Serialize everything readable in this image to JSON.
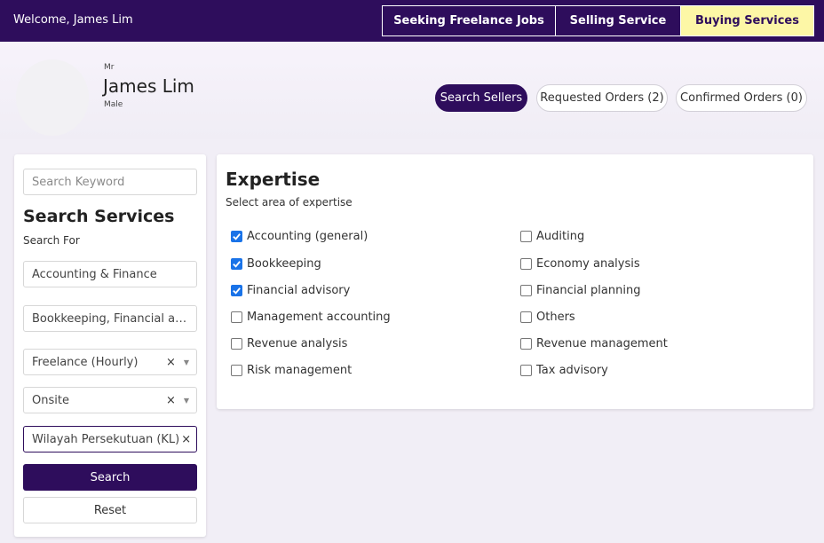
{
  "header": {
    "welcome": "Welcome, James Lim",
    "tabs": [
      {
        "label": "Seeking Freelance Jobs"
      },
      {
        "label": "Selling Service"
      },
      {
        "label": "Buying Services"
      }
    ],
    "active_tab": "Buying Services",
    "colors": {
      "bar": "#2e0d5c",
      "active_tab": "#fdf7a6"
    }
  },
  "profile": {
    "salutation": "Mr",
    "name": "James Lim",
    "gender": "Male"
  },
  "actions": {
    "search_sellers": "Search Sellers",
    "requested_orders": "Requested Orders (2)",
    "confirmed_orders": "Confirmed Orders (0)"
  },
  "sidebar": {
    "keyword_placeholder": "Search Keyword",
    "title": "Search Services",
    "search_for_label": "Search For",
    "category_value": "Accounting & Finance",
    "expertise_value": "Bookkeeping, Financial advisory, Accounting (general)",
    "job_type_value": "Freelance (Hourly)",
    "location_type_value": "Onsite",
    "region_value": "Wilayah Persekutuan (KL)",
    "clear_symbol": "×",
    "search_button": "Search",
    "reset_button": "Reset"
  },
  "expertise": {
    "title": "Expertise",
    "subtitle": "Select area of expertise",
    "options": [
      {
        "label": "Accounting (general)",
        "checked": true
      },
      {
        "label": "Bookkeeping",
        "checked": true
      },
      {
        "label": "Financial advisory",
        "checked": true
      },
      {
        "label": "Management accounting",
        "checked": false
      },
      {
        "label": "Revenue analysis",
        "checked": false
      },
      {
        "label": "Risk management",
        "checked": false
      },
      {
        "label": "Auditing",
        "checked": false
      },
      {
        "label": "Economy analysis",
        "checked": false
      },
      {
        "label": "Financial planning",
        "checked": false
      },
      {
        "label": "Others",
        "checked": false
      },
      {
        "label": "Revenue management",
        "checked": false
      },
      {
        "label": "Tax advisory",
        "checked": false
      }
    ]
  }
}
